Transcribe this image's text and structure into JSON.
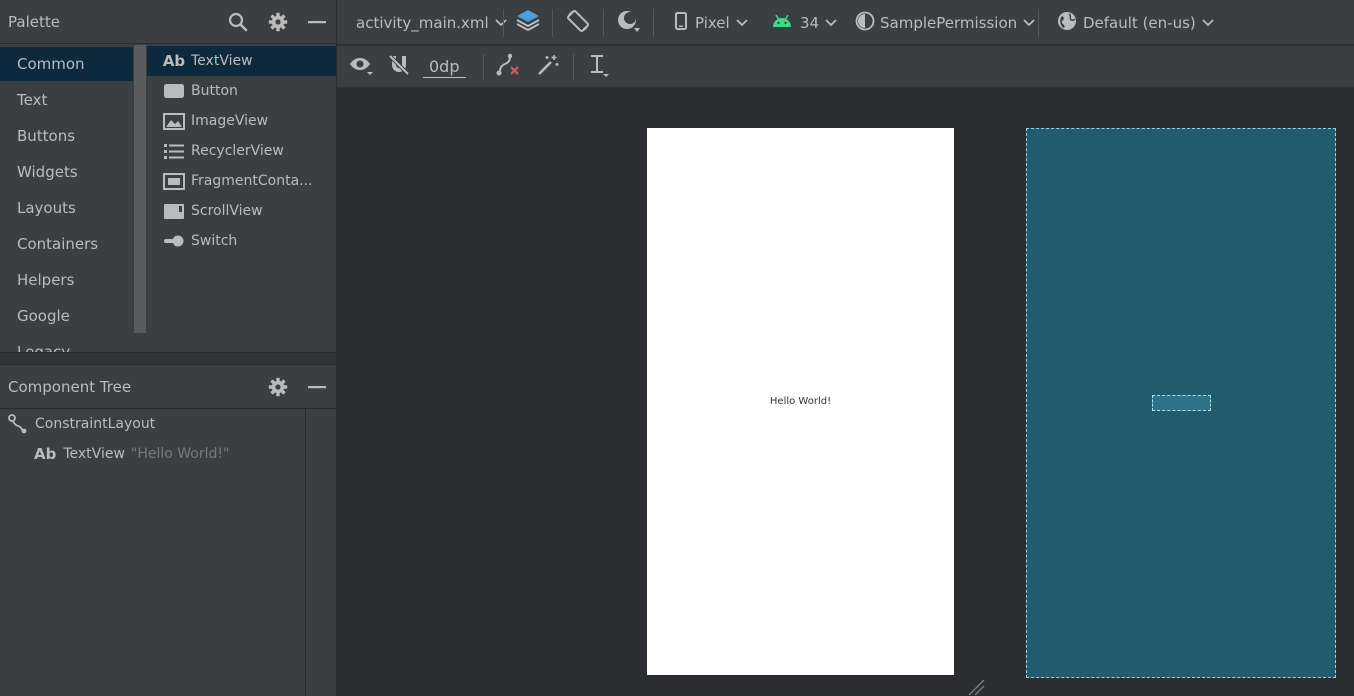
{
  "palette": {
    "title": "Palette",
    "categories": [
      "Common",
      "Text",
      "Buttons",
      "Widgets",
      "Layouts",
      "Containers",
      "Helpers",
      "Google",
      "Legacy"
    ],
    "widgets": [
      {
        "icon": "textview-icon",
        "label": "TextView"
      },
      {
        "icon": "button-icon",
        "label": "Button"
      },
      {
        "icon": "imageview-icon",
        "label": "ImageView"
      },
      {
        "icon": "recyclerview-icon",
        "label": "RecyclerView"
      },
      {
        "icon": "fragmentcontainer-icon",
        "label": "FragmentConta..."
      },
      {
        "icon": "scrollview-icon",
        "label": "ScrollView"
      },
      {
        "icon": "switch-icon",
        "label": "Switch"
      }
    ],
    "textview_glyph": "Ab"
  },
  "component_tree": {
    "title": "Component Tree",
    "root": "ConstraintLayout",
    "child_glyph": "Ab",
    "child": "TextView",
    "child_text": "\"Hello World!\""
  },
  "toolbar": {
    "file": "activity_main.xml",
    "device": "Pixel",
    "api": "34",
    "theme": "SamplePermission",
    "locale": "Default (en-us)",
    "margin": "0dp"
  },
  "canvas": {
    "hello_text": "Hello World!"
  },
  "colors": {
    "panel": "#3c3f41",
    "editor_bg": "#2b2d30",
    "selection": "#0d293e",
    "blueprint": "#225a6e",
    "android_green": "#3ddc84",
    "layers_blue": "#4a9fe0"
  }
}
